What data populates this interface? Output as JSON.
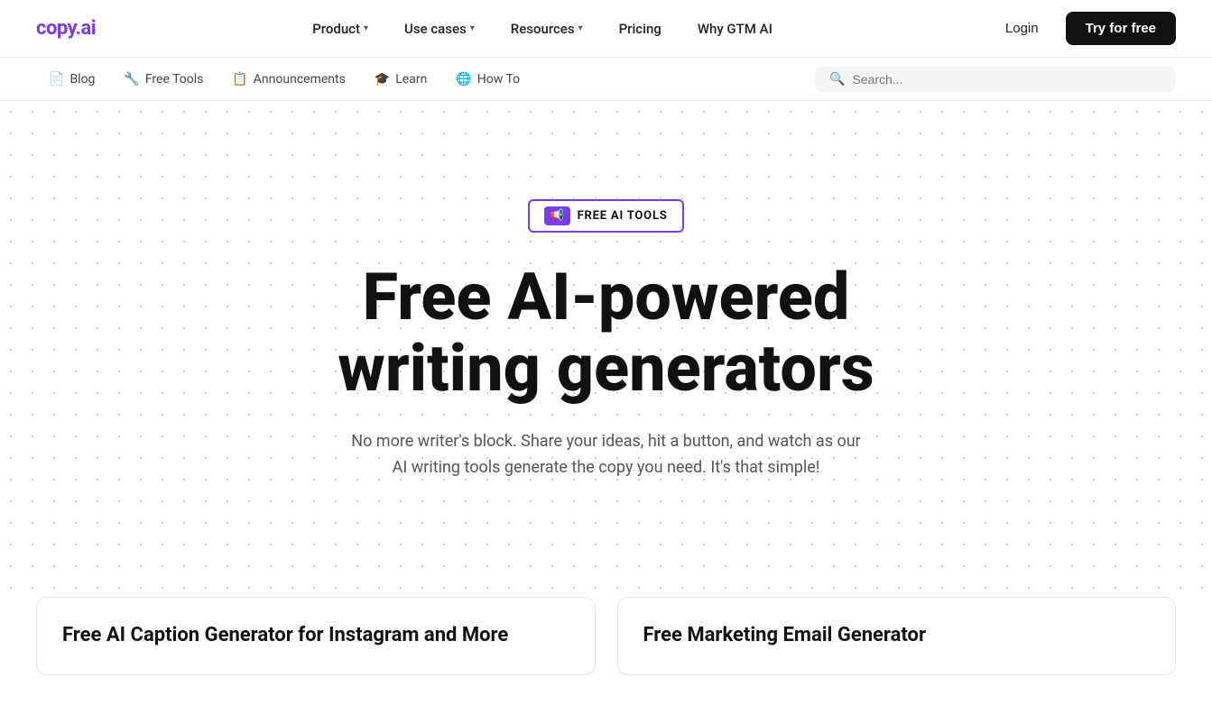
{
  "logo": {
    "text": "copy.ai"
  },
  "topNav": {
    "items": [
      {
        "label": "Product",
        "hasDropdown": true
      },
      {
        "label": "Use cases",
        "hasDropdown": true
      },
      {
        "label": "Resources",
        "hasDropdown": true
      },
      {
        "label": "Pricing",
        "hasDropdown": false
      },
      {
        "label": "Why GTM AI",
        "hasDropdown": false
      }
    ],
    "login_label": "Login",
    "try_label": "Try for free"
  },
  "subNav": {
    "items": [
      {
        "label": "Blog",
        "icon": "📄"
      },
      {
        "label": "Free Tools",
        "icon": "🔧"
      },
      {
        "label": "Announcements",
        "icon": "📋"
      },
      {
        "label": "Learn",
        "icon": "🎓"
      },
      {
        "label": "How To",
        "icon": "🌐"
      }
    ],
    "search": {
      "placeholder": "Search..."
    }
  },
  "hero": {
    "badge": "FREE AI TOOLS",
    "title": "Free AI-powered writing generators",
    "subtitle": "No more writer's block. Share your ideas, hit a button, and watch as our AI writing tools generate the copy you need. It's that simple!"
  },
  "cards": [
    {
      "title": "Free AI Caption Generator for Instagram and More"
    },
    {
      "title": "Free Marketing Email Generator"
    }
  ]
}
